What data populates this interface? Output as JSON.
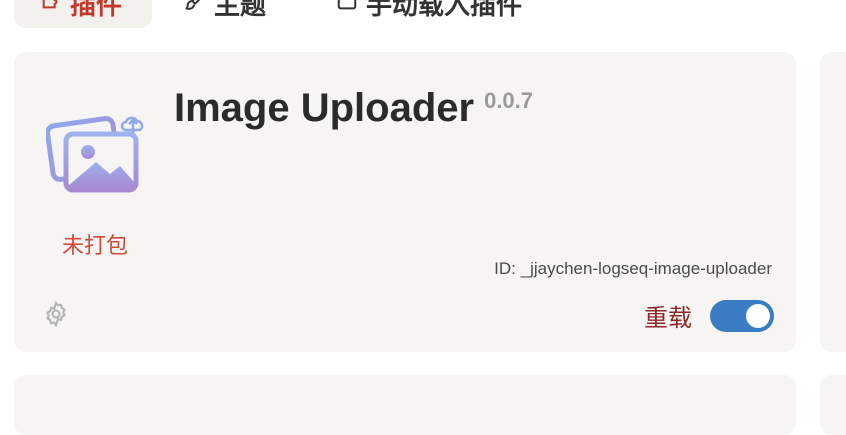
{
  "tabs": [
    {
      "label": "插件",
      "icon": "puzzle-icon",
      "active": true
    },
    {
      "label": "主题",
      "icon": "brush-icon",
      "active": false
    },
    {
      "label": "手动载入插件",
      "icon": "folder-icon",
      "active": false
    }
  ],
  "plugin": {
    "name": "Image Uploader",
    "version": "0.0.7",
    "status": "未打包",
    "id_text": "ID: _jjaychen-logseq-image-uploader",
    "reload_label": "重载",
    "enabled": true,
    "icon": "image-upload-icon"
  },
  "colors": {
    "active_tab_text": "#c0392b",
    "status_text": "#d24a3c",
    "reload_text": "#8b2b28",
    "toggle_on": "#3a7dc4",
    "card_bg": "#f6f5f4"
  }
}
